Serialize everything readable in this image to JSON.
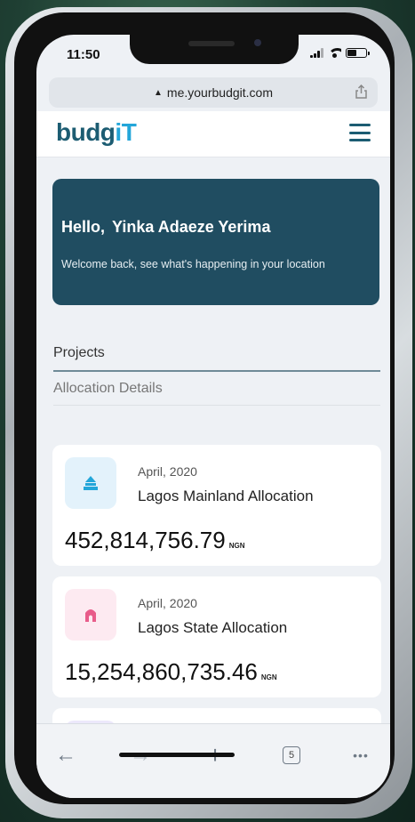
{
  "status": {
    "time": "11:50"
  },
  "browser": {
    "url": "me.yourbudgit.com",
    "toolbar": {
      "back": "←",
      "forward": "→",
      "new_tab": "+",
      "tabs_count": "5",
      "more": "•••"
    }
  },
  "header": {
    "logo_main": "budg",
    "logo_accent": "iT"
  },
  "welcome": {
    "greeting": "Hello,",
    "user_name": "Yinka Adaeze Yerima",
    "message": "Welcome back, see what's happening in your location"
  },
  "tabs": [
    {
      "label": "Projects",
      "active": true
    },
    {
      "label": "Allocation Details",
      "active": false
    }
  ],
  "allocations": [
    {
      "date": "April, 2020",
      "name": "Lagos Mainland Allocation",
      "amount": "452,814,756.79",
      "currency": "NGN",
      "icon": "building-icon",
      "color": "#23a6d9",
      "bg": "#e3f2fb"
    },
    {
      "date": "April, 2020",
      "name": "Lagos State Allocation",
      "amount": "15,254,860,735.46",
      "currency": "NGN",
      "icon": "arch-icon",
      "color": "#e85c8a",
      "bg": "#fdeaf1"
    }
  ]
}
